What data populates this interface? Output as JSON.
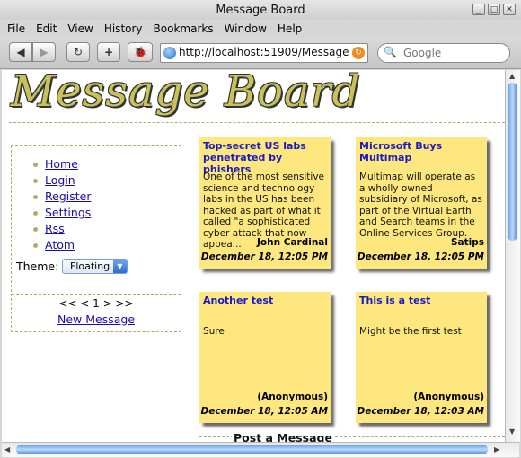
{
  "window": {
    "title": "Message Board"
  },
  "menu": [
    "File",
    "Edit",
    "View",
    "History",
    "Bookmarks",
    "Window",
    "Help"
  ],
  "toolbar": {
    "back": "◀",
    "forward": "▶",
    "reload": "↻",
    "add": "+",
    "bug": "🐞",
    "url": "http://localhost:51909/Message",
    "rss": "↻",
    "search_placeholder": "Google",
    "search_icon": "🔍"
  },
  "page": {
    "logo": "Message Board",
    "nav": [
      "Home",
      "Login",
      "Register",
      "Settings",
      "Rss",
      "Atom"
    ],
    "theme_label": "Theme:",
    "theme_value": "Floating",
    "pager": "<< < 1 > >>",
    "new_message": "New Message",
    "post_heading": "Post a Message"
  },
  "notes": [
    {
      "title": "Top-secret US labs penetrated by phishers",
      "body": "One of the most sensitive science and technology labs in the US has been hacked as part of what it called \"a sophisticated cyber attack that now appea...",
      "author": "John Cardinal",
      "date": "December 18, 12:05 PM"
    },
    {
      "title": "Microsoft Buys Multimap",
      "body": "Multimap will operate as a wholly owned subsidiary of Microsoft, as part of the Virtual Earth and Search teams in the Online Services Group.",
      "author": "Satips",
      "date": "December 18, 12:05 PM"
    },
    {
      "title": "Another test",
      "body": "Sure",
      "author": "(Anonymous)",
      "date": "December 18, 12:05 AM"
    },
    {
      "title": "This is a test",
      "body": "Might be the first test",
      "author": "(Anonymous)",
      "date": "December 18, 12:03 AM"
    }
  ]
}
